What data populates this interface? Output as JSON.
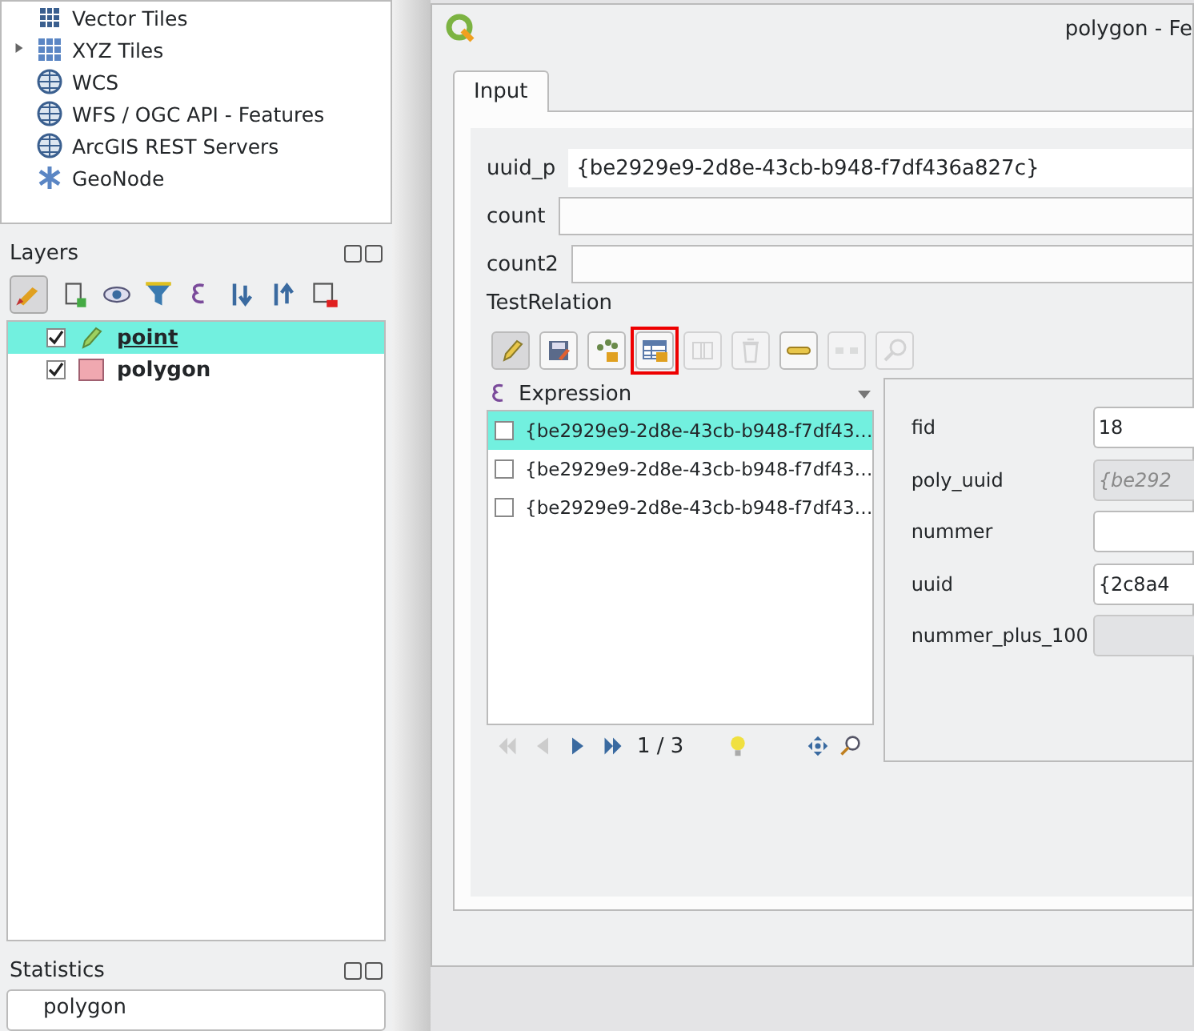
{
  "browser": {
    "items": [
      {
        "label": "Vector Tiles",
        "expandable": false
      },
      {
        "label": "XYZ Tiles",
        "expandable": true
      },
      {
        "label": "WCS",
        "expandable": false
      },
      {
        "label": "WFS / OGC API - Features",
        "expandable": false
      },
      {
        "label": "ArcGIS REST Servers",
        "expandable": false
      },
      {
        "label": "GeoNode",
        "expandable": false
      }
    ]
  },
  "layers": {
    "title": "Layers",
    "items": [
      {
        "name": "point",
        "kind": "point",
        "checked": true,
        "selected": true,
        "current": true
      },
      {
        "name": "polygon",
        "kind": "polygon",
        "checked": true,
        "selected": false,
        "current": false
      }
    ]
  },
  "statistics": {
    "title": "Statistics",
    "layer": "polygon"
  },
  "dialog": {
    "title": "polygon - Fe",
    "tabs": [
      {
        "label": "Input",
        "selected": true
      }
    ],
    "fields": [
      {
        "label": "uuid_p",
        "value": "{be2929e9-2d8e-43cb-b948-f7df436a827c}"
      },
      {
        "label": "count"
      },
      {
        "label": "count2"
      }
    ],
    "relation": {
      "label": "TestRelation",
      "tools": [
        {
          "disabled": false,
          "highlighted": false,
          "pressed": true
        },
        {
          "disabled": false,
          "highlighted": false,
          "pressed": false
        },
        {
          "disabled": false,
          "highlighted": false,
          "pressed": false
        },
        {
          "disabled": false,
          "highlighted": true,
          "pressed": false
        },
        {
          "disabled": true,
          "highlighted": false,
          "pressed": false
        },
        {
          "disabled": true,
          "highlighted": false,
          "pressed": false
        },
        {
          "disabled": false,
          "highlighted": false,
          "pressed": false
        },
        {
          "disabled": true,
          "highlighted": false,
          "pressed": false
        },
        {
          "disabled": true,
          "highlighted": false,
          "pressed": false
        }
      ],
      "list_header": "Expression",
      "rows": [
        {
          "text": "{be2929e9-2d8e-43cb-b948-f7df43…",
          "checked": false,
          "selected": true
        },
        {
          "text": "{be2929e9-2d8e-43cb-b948-f7df43…",
          "checked": false,
          "selected": false
        },
        {
          "text": "{be2929e9-2d8e-43cb-b948-f7df43…",
          "checked": false,
          "selected": false
        }
      ],
      "page": "1 / 3",
      "form": [
        {
          "label": "fid",
          "value": "18",
          "disabled": false
        },
        {
          "label": "poly_uuid",
          "value": "{be292",
          "disabled": true
        },
        {
          "label": "nummer",
          "disabled": false
        },
        {
          "label": "uuid",
          "value": "{2c8a4",
          "disabled": false
        },
        {
          "label": "nummer_plus_100",
          "disabled": true
        }
      ]
    }
  }
}
